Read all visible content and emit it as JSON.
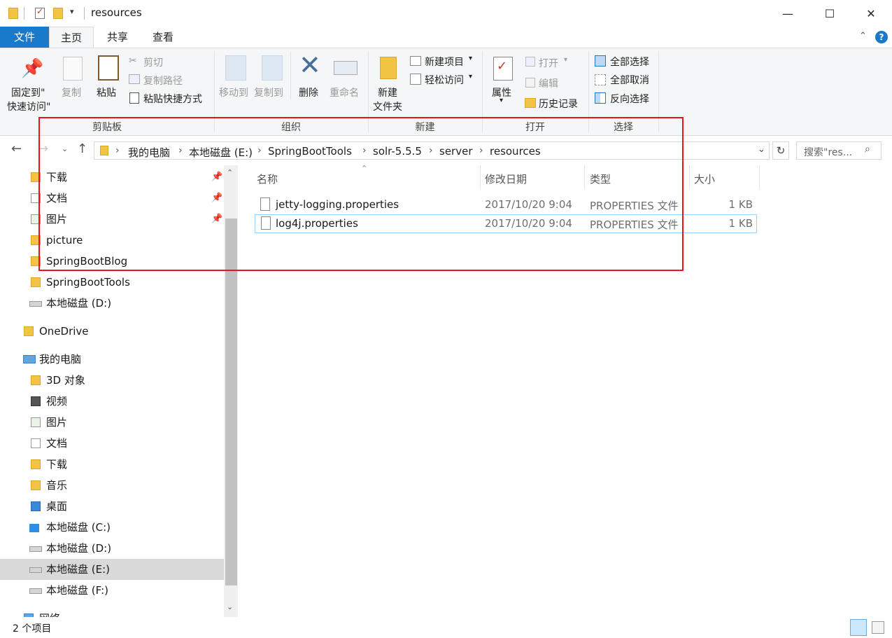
{
  "window": {
    "title": "resources",
    "buttons": {
      "minimize": "—",
      "maximize": "☐",
      "close": "✕"
    }
  },
  "tabs": [
    {
      "label": "文件"
    },
    {
      "label": "主页"
    },
    {
      "label": "共享"
    },
    {
      "label": "查看"
    }
  ],
  "ribbon": {
    "clipboard": {
      "group_label": "剪贴板",
      "pin_label_1": "固定到\"",
      "pin_label_2": "快速访问\"",
      "copy": "复制",
      "paste": "粘贴",
      "cut": "剪切",
      "copy_path": "复制路径",
      "paste_shortcut": "粘贴快捷方式"
    },
    "organize": {
      "group_label": "组织",
      "move_to": "移动到",
      "copy_to": "复制到",
      "delete": "删除",
      "rename": "重命名"
    },
    "new": {
      "group_label": "新建",
      "new_folder_1": "新建",
      "new_folder_2": "文件夹",
      "new_item": "新建项目",
      "easy_access": "轻松访问"
    },
    "open": {
      "group_label": "打开",
      "properties": "属性",
      "open": "打开",
      "edit": "编辑",
      "history": "历史记录"
    },
    "select": {
      "group_label": "选择",
      "select_all": "全部选择",
      "select_none": "全部取消",
      "invert": "反向选择"
    }
  },
  "address": {
    "crumbs": [
      "我的电脑",
      "本地磁盘 (E:)",
      "SpringBootTools",
      "solr-5.5.5",
      "server",
      "resources"
    ],
    "search_placeholder": "搜索\"res..."
  },
  "nav": {
    "items": [
      {
        "label": "下载",
        "pinned": true
      },
      {
        "label": "文档",
        "pinned": true
      },
      {
        "label": "图片",
        "pinned": true
      },
      {
        "label": "picture"
      },
      {
        "label": "SpringBootBlog"
      },
      {
        "label": "SpringBootTools"
      },
      {
        "label": "本地磁盘 (D:)"
      },
      {
        "label": "OneDrive"
      },
      {
        "label": "我的电脑"
      },
      {
        "label": "3D 对象"
      },
      {
        "label": "视频"
      },
      {
        "label": "图片"
      },
      {
        "label": "文档"
      },
      {
        "label": "下载"
      },
      {
        "label": "音乐"
      },
      {
        "label": "桌面"
      },
      {
        "label": "本地磁盘 (C:)"
      },
      {
        "label": "本地磁盘 (D:)"
      },
      {
        "label": "本地磁盘 (E:)",
        "selected": true
      },
      {
        "label": "本地磁盘 (F:)"
      },
      {
        "label": "网络"
      }
    ]
  },
  "files": {
    "columns": {
      "name": "名称",
      "date": "修改日期",
      "type": "类型",
      "size": "大小"
    },
    "rows": [
      {
        "name": "jetty-logging.properties",
        "date": "2017/10/20 9:04",
        "type": "PROPERTIES 文件",
        "size": "1 KB"
      },
      {
        "name": "log4j.properties",
        "date": "2017/10/20 9:04",
        "type": "PROPERTIES 文件",
        "size": "1 KB"
      }
    ]
  },
  "status": {
    "count": "2 个项目"
  },
  "colors": {
    "accent": "#1979ca",
    "annotation": "#e8141c",
    "selected": "#cce8ff"
  }
}
